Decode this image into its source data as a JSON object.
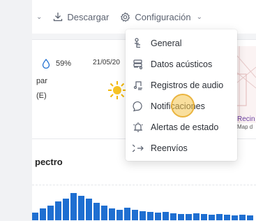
{
  "toolbar": {
    "download_label": "Descargar",
    "settings_label": "Configuración"
  },
  "weather": {
    "humidity": "59%",
    "partial_line_1": "par",
    "partial_line_2": "(E)",
    "date_partial": "21/05/20"
  },
  "map": {
    "label_1": "Recin",
    "label_2": "Map d"
  },
  "spectrum": {
    "title_partial": "pectro"
  },
  "menu": {
    "items": [
      {
        "label": "General",
        "icon": "person-tree-icon"
      },
      {
        "label": "Datos acústicos",
        "icon": "database-icon"
      },
      {
        "label": "Registros de audio",
        "icon": "audio-file-icon"
      },
      {
        "label": "Notificaciones",
        "icon": "chat-bubble-icon"
      },
      {
        "label": "Alertas de estado",
        "icon": "alert-bell-icon"
      },
      {
        "label": "Reenvíos",
        "icon": "forward-arrow-icon"
      }
    ]
  },
  "colors": {
    "accent": "#1f6fd1",
    "cursor_highlight": "#f4c44c"
  }
}
